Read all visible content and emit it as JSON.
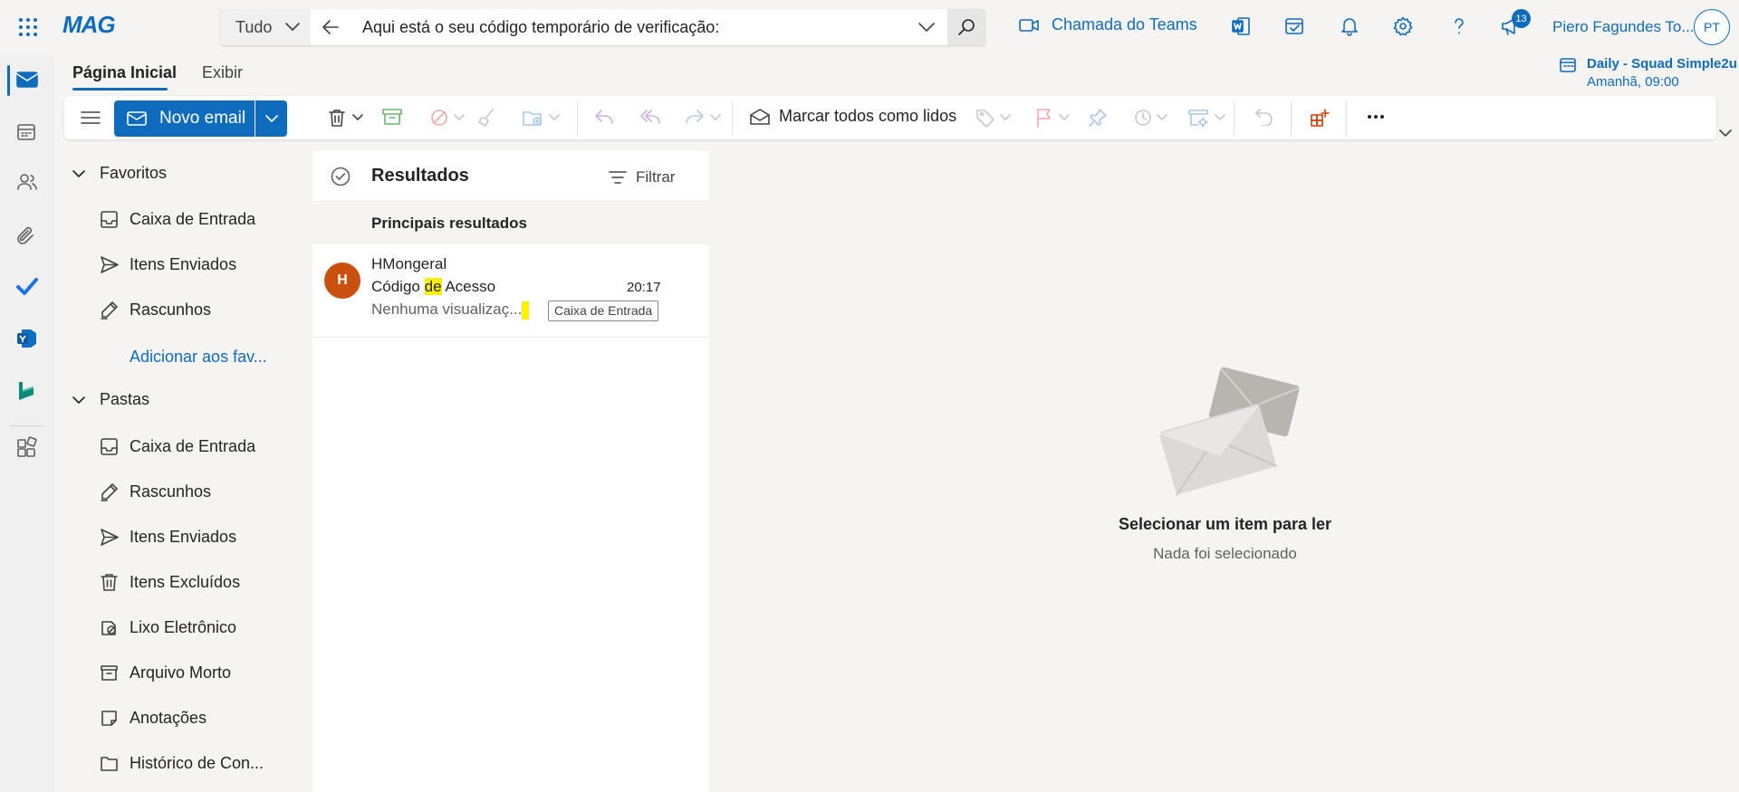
{
  "app": {
    "brand": "MAG"
  },
  "search": {
    "scope": "Tudo",
    "query": "Aqui está o seu código temporário de verificação:"
  },
  "header": {
    "teams_call": "Chamada do Teams",
    "notification_count": "13",
    "user_name": "Piero Fagundes To...",
    "user_initials": "PT"
  },
  "ribbon": {
    "tabs": [
      "Página Inicial",
      "Exibir"
    ],
    "new_email": "Novo email",
    "mark_all_read": "Marcar todos como lidos",
    "meeting": {
      "title": "Daily - Squad Simple2u",
      "time": "Amanhã, 09:00"
    }
  },
  "folders": {
    "favorites_header": "Favoritos",
    "favorites": [
      "Caixa de Entrada",
      "Itens Enviados",
      "Rascunhos"
    ],
    "add_favorite": "Adicionar aos fav...",
    "folders_header": "Pastas",
    "items": [
      "Caixa de Entrada",
      "Rascunhos",
      "Itens Enviados",
      "Itens Excluídos",
      "Lixo Eletrônico",
      "Arquivo Morto",
      "Anotações",
      "Histórico de Con..."
    ]
  },
  "message_list": {
    "title": "Resultados",
    "filter": "Filtrar",
    "section": "Principais resultados",
    "messages": [
      {
        "initial": "H",
        "sender": "HMongeral",
        "subject_before": "Código ",
        "subject_highlight": "de",
        "subject_after": " Acesso",
        "time": "20:17",
        "preview": "Nenhuma visualizaç...",
        "folder": "Caixa de Entrada"
      }
    ]
  },
  "reading_pane": {
    "title": "Selecionar um item para ler",
    "subtitle": "Nada foi selecionado"
  },
  "colors": {
    "accent": "#0f6cbd",
    "avatar": "#ca5010",
    "highlight": "#fff100"
  }
}
